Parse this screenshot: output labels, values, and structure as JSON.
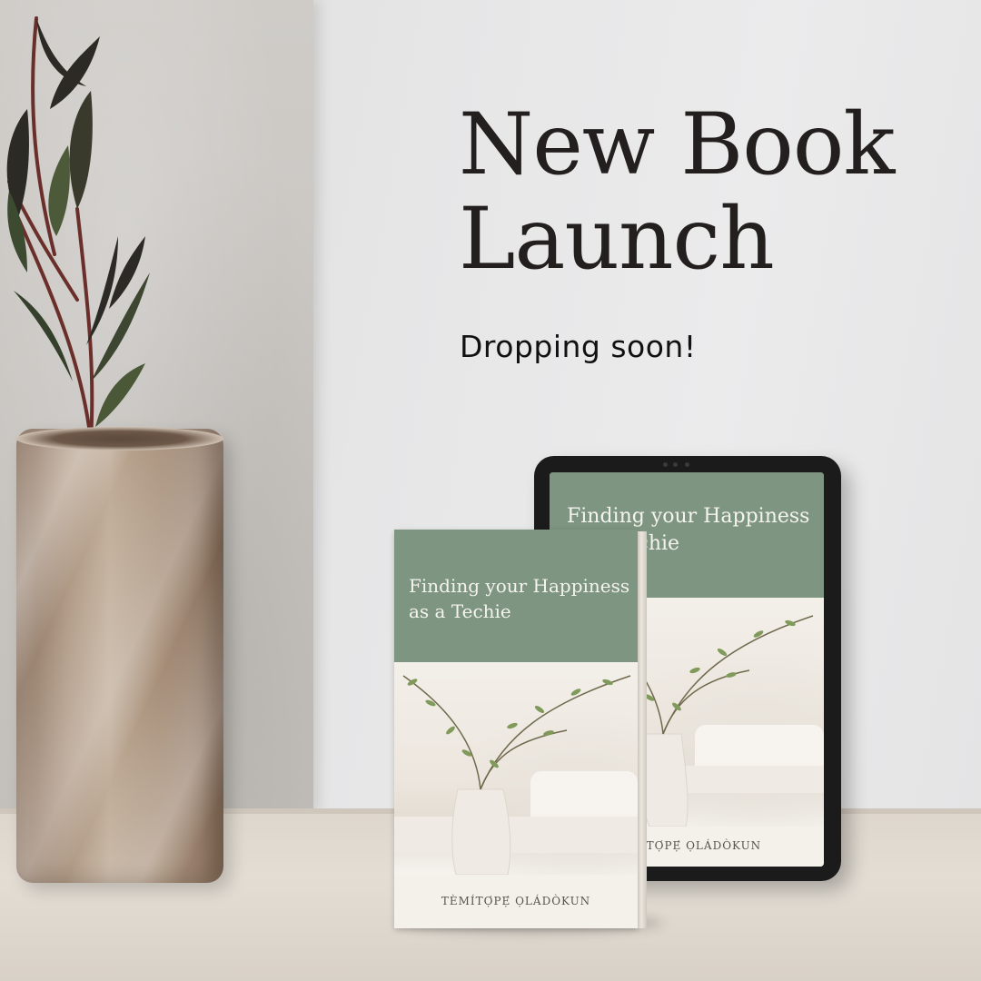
{
  "heading": {
    "line1": "New Book",
    "line2": "Launch"
  },
  "subtitle": "Dropping soon!",
  "tablet": {
    "title": "Finding your Happiness as a Techie",
    "author": "TÈMÍTỌ́PẸ́ ỌLÁDÒKUN"
  },
  "book": {
    "title_line1": "Finding your Happiness",
    "title_line2": "as a Techie",
    "author": "TÈMÍTỌ́PẸ́ ỌLÁDÒKUN"
  },
  "colors": {
    "cover_green": "#7d9581",
    "title_text": "#231f1f",
    "wall": "#e9e9ea"
  }
}
